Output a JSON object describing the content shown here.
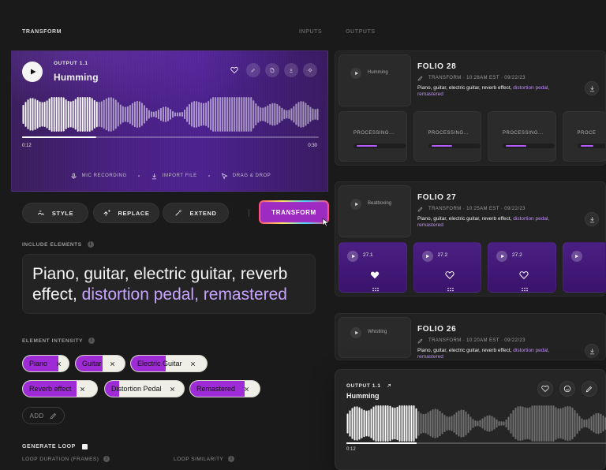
{
  "top": {
    "title": "TRANSFORM",
    "tabs": [
      {
        "label": "INPUTS"
      },
      {
        "label": "OUTPUTS"
      }
    ]
  },
  "hero": {
    "kicker": "OUTPUT 1.1",
    "title": "Humming",
    "time_start": "0:12",
    "time_end": "0:30",
    "progress": 0.25,
    "footer": [
      {
        "label": "MIC RECORDING",
        "icon": "mic-icon"
      },
      {
        "label": "IMPORT FILE",
        "icon": "import-icon"
      },
      {
        "label": "DRAG & DROP",
        "icon": "cursor-icon"
      }
    ]
  },
  "controls": {
    "style": "STYLE",
    "replace": "REPLACE",
    "extend": "EXTEND",
    "transform": "TRANSFORM"
  },
  "include_elements": {
    "label": "INCLUDE ELEMENTS",
    "text_main": "Piano, guitar, electric guitar, reverb effect,",
    "text_muted": "distortion pedal, remastered"
  },
  "element_intensity": {
    "label": "ELEMENT INTENSITY",
    "chips": [
      {
        "label": "Piano",
        "intensity": 0.78
      },
      {
        "label": "Guitar",
        "intensity": 0.55
      },
      {
        "label": "Electric Guitar",
        "intensity": 0.46
      },
      {
        "label": "Reverb effect",
        "intensity": 0.72
      },
      {
        "label": "Distortion Pedal",
        "intensity": 0.18
      },
      {
        "label": "Remastered",
        "intensity": 0.78
      }
    ],
    "add_label": "ADD"
  },
  "generate_loop": {
    "label": "GENERATE LOOP",
    "loop_duration": "LOOP DURATION (FRAMES)",
    "loop_similarity": "LOOP SIMILARITY"
  },
  "folios": [
    {
      "title": "FOLIO 28",
      "thumb_label": "Humming",
      "meta": "TRANSFORM · 10:28AM EST · 09/22/23",
      "desc_main": "Piano, guitar, electric guitar, reverb effect,",
      "desc_muted": "distortion pedal, remastered",
      "processing_cards": [
        "PROCESSING...",
        "PROCESSING...",
        "PROCESSING...",
        "PROCE"
      ]
    },
    {
      "title": "FOLIO 27",
      "thumb_label": "Beatboxing",
      "meta": "TRANSFORM · 10:25AM EST · 09/22/23",
      "desc_main": "Piano, guitar, electric guitar, reverb effect,",
      "desc_muted": "distortion pedal, remastered",
      "version_cards": [
        "27.1",
        "27.2",
        "27.2",
        ""
      ]
    },
    {
      "title": "FOLIO 26",
      "thumb_label": "Whistling",
      "meta": "TRANSFORM · 10:20AM EST · 09/22/23",
      "desc_main": "Piano, guitar, electric guitar, reverb effect,",
      "desc_muted": "distortion pedal, remastered"
    }
  ],
  "overlay": {
    "kicker": "OUTPUT 1.1",
    "title": "Humming",
    "time": "0:12",
    "progress": 0.27
  },
  "colors": {
    "accent_purple": "#9f2bd6",
    "muted_purple_text": "#b58cff"
  }
}
